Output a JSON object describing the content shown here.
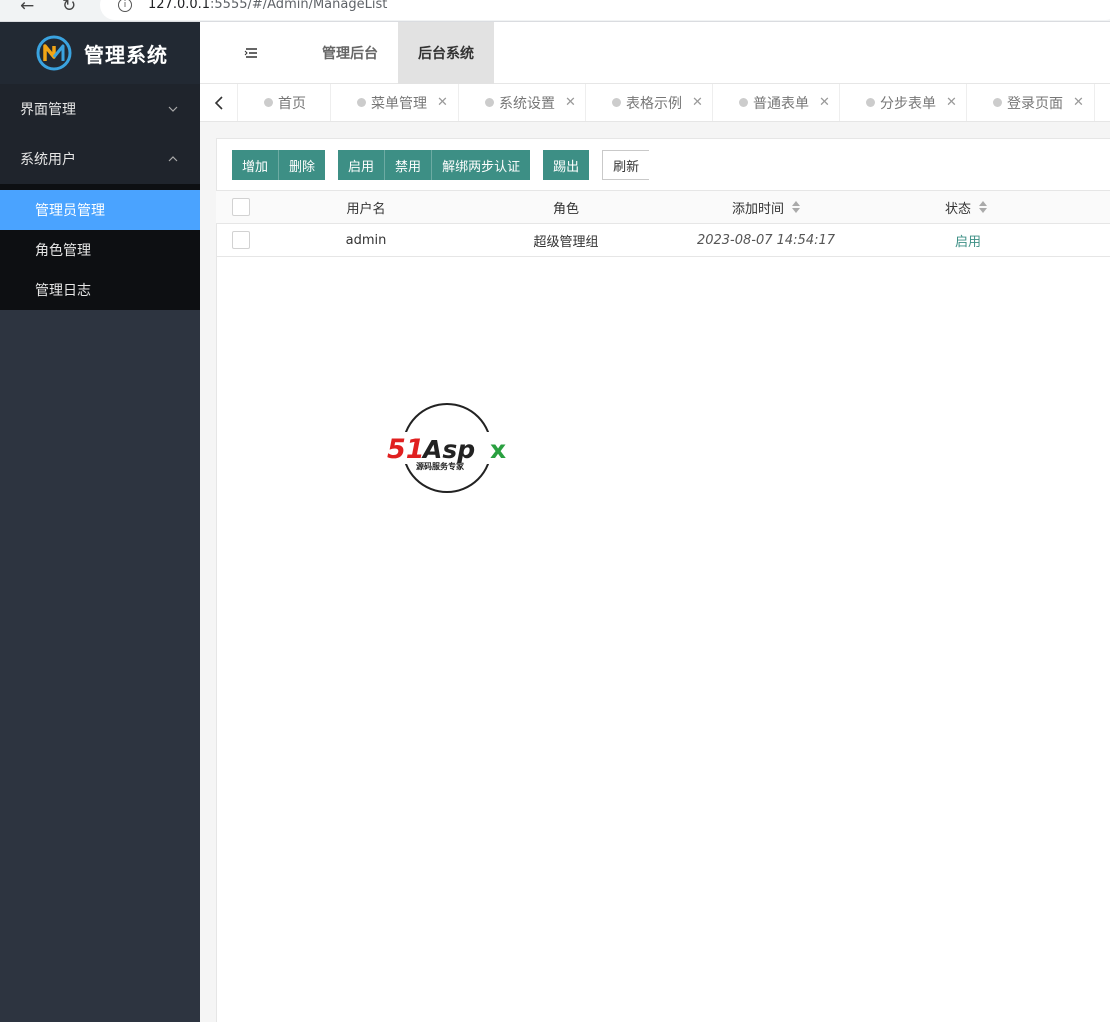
{
  "browser": {
    "url_host": "127.0.0.1",
    "url_path": ":5555/#/Admin/ManageList"
  },
  "app": {
    "title": "管理系统"
  },
  "sidebar": {
    "menus": [
      {
        "label": "界面管理",
        "expanded": false
      },
      {
        "label": "系统用户",
        "expanded": true
      }
    ],
    "submenu": [
      {
        "label": "管理员管理",
        "active": true
      },
      {
        "label": "角色管理",
        "active": false
      },
      {
        "label": "管理日志",
        "active": false
      }
    ]
  },
  "header": {
    "tabs": [
      {
        "label": "管理后台",
        "active": false
      },
      {
        "label": "后台系统",
        "active": true
      }
    ]
  },
  "tabstrip": {
    "tabs": [
      {
        "label": "首页",
        "closable": false
      },
      {
        "label": "菜单管理",
        "closable": true
      },
      {
        "label": "系统设置",
        "closable": true
      },
      {
        "label": "表格示例",
        "closable": true
      },
      {
        "label": "普通表单",
        "closable": true
      },
      {
        "label": "分步表单",
        "closable": true
      },
      {
        "label": "登录页面",
        "closable": true
      }
    ]
  },
  "toolbar": {
    "add": "增加",
    "delete": "删除",
    "enable": "启用",
    "disable": "禁用",
    "unbind_2fa": "解绑两步认证",
    "kick": "踢出",
    "refresh": "刷新"
  },
  "table": {
    "columns": [
      "用户名",
      "角色",
      "添加时间",
      "状态"
    ],
    "rows": [
      {
        "username": "admin",
        "role": "超级管理组",
        "added": "2023-08-07 14:54:17",
        "status": "启用"
      }
    ]
  },
  "watermark": {
    "brand": "51Aspx",
    "tagline": "源码服务专家"
  },
  "colors": {
    "sidebar_bg": "#2d3440",
    "active_menu": "#4aa3ff",
    "button": "#3d8f85"
  }
}
